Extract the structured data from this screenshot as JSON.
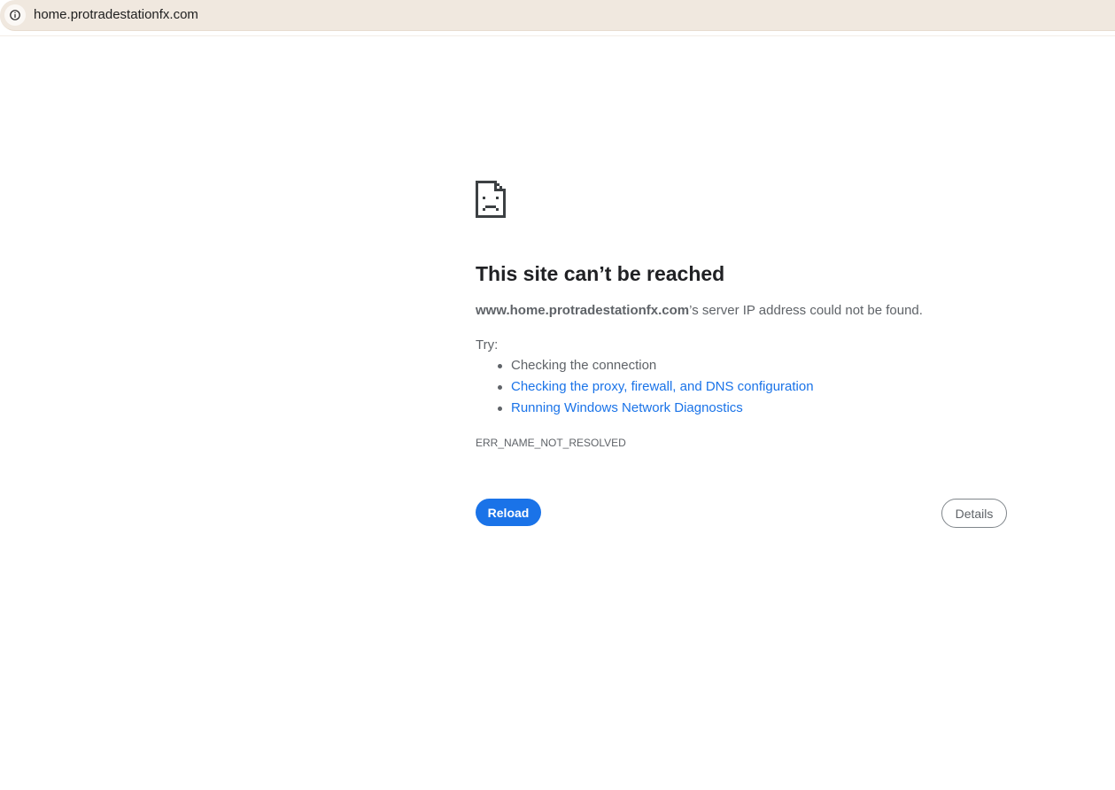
{
  "address_bar": {
    "url": "home.protradestationfx.com",
    "icon": "info-icon"
  },
  "error_page": {
    "icon": "sad-page-icon",
    "heading": "This site can’t be reached",
    "host": "www.home.protradestationfx.com",
    "message_suffix": "’s server IP address could not be found.",
    "try_label": "Try:",
    "suggestions": [
      {
        "text": "Checking the connection",
        "is_link": false
      },
      {
        "text": "Checking the proxy, firewall, and DNS configuration",
        "is_link": true
      },
      {
        "text": "Running Windows Network Diagnostics",
        "is_link": true
      }
    ],
    "error_code": "ERR_NAME_NOT_RESOLVED",
    "reload_label": "Reload",
    "details_label": "Details"
  },
  "colors": {
    "accent": "#1a73e8",
    "text": "#5f6368",
    "heading": "#202124",
    "address_bar_bg": "#f0e8df"
  }
}
